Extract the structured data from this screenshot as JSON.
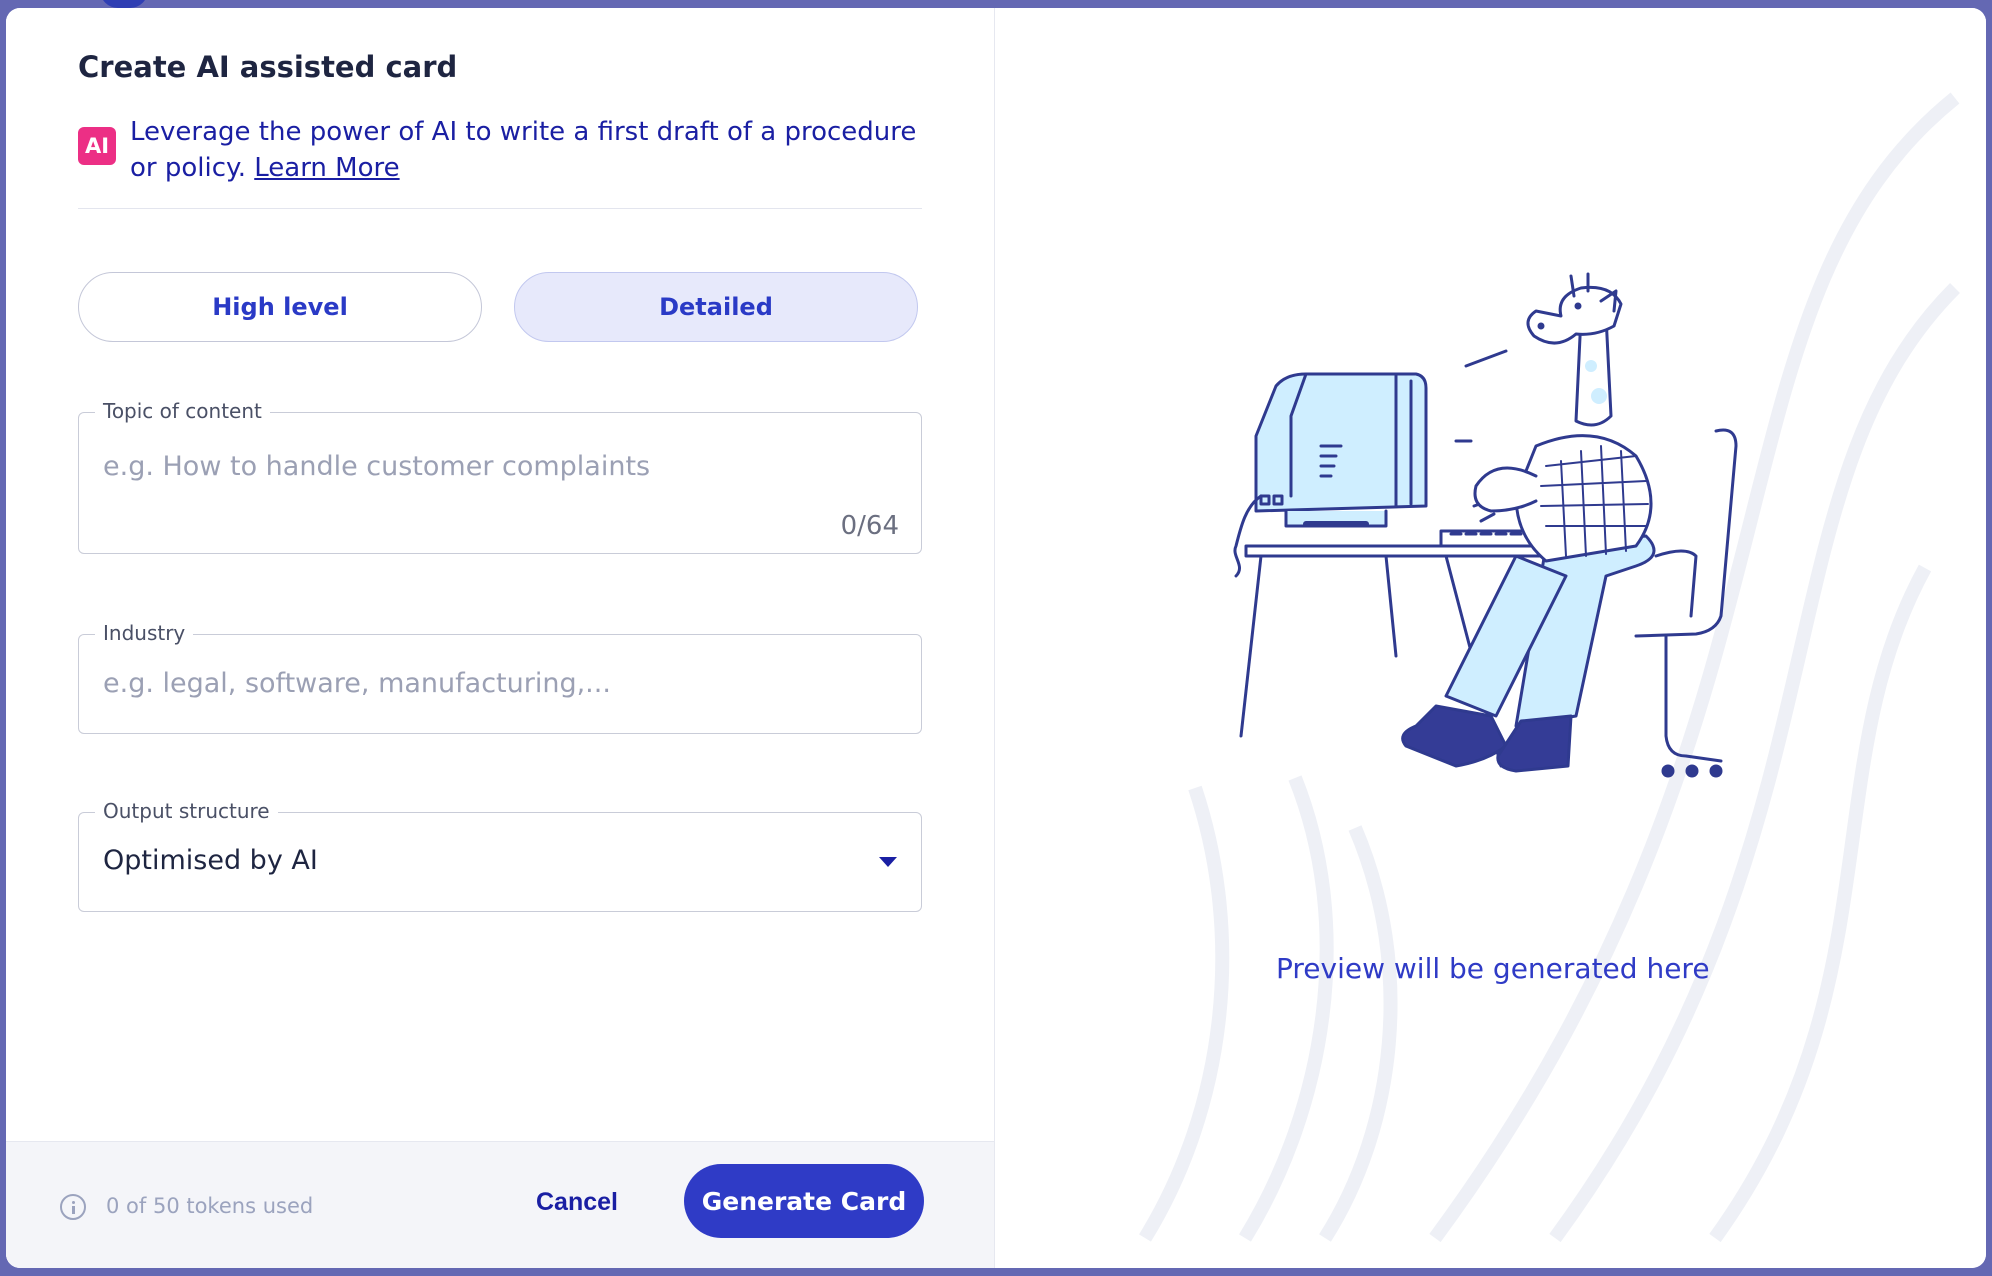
{
  "dialog": {
    "title": "Create AI assisted card",
    "ai_badge": "AI",
    "intro_text": "Leverage the power of AI to write a first draft of a procedure or policy.",
    "learn_more": "Learn More"
  },
  "mode_toggle": {
    "options": [
      "High level",
      "Detailed"
    ],
    "selected": "Detailed"
  },
  "topic_field": {
    "label": "Topic of content",
    "placeholder": "e.g. How to handle customer complaints",
    "counter": "0/64"
  },
  "industry_field": {
    "label": "Industry",
    "placeholder": "e.g. legal, software, manufacturing,..."
  },
  "output_field": {
    "label": "Output structure",
    "value": "Optimised by AI"
  },
  "footer": {
    "tokens": "0 of 50 tokens used",
    "cancel": "Cancel",
    "generate": "Generate Card"
  },
  "preview": {
    "text": "Preview will be generated here",
    "illustration": "giraffe-at-computer"
  },
  "colors": {
    "accent": "#2f3bc6",
    "ai_badge": "#ec2f85",
    "backdrop": "#6468b3",
    "selected_pill": "#e7e9fb"
  }
}
